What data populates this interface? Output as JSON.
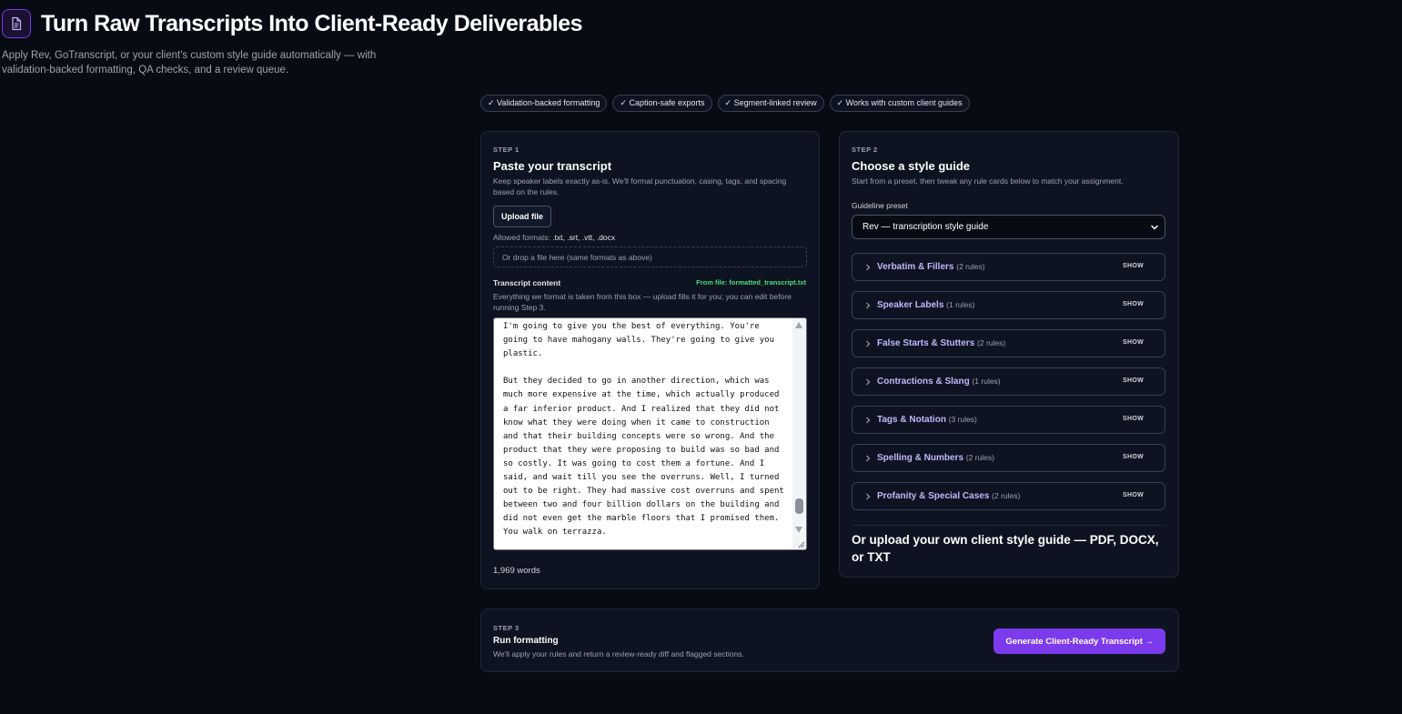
{
  "header": {
    "title": "Turn Raw Transcripts Into Client-Ready Deliverables",
    "subtitle": "Apply Rev, GoTranscript, or your client's custom style guide automatically — with validation-backed formatting, QA checks, and a review queue."
  },
  "features": [
    "✓ Validation-backed formatting",
    "✓ Caption-safe exports",
    "✓ Segment-linked review",
    "✓ Works with custom client guides"
  ],
  "step1": {
    "step_label": "STEP 1",
    "title": "Paste your transcript",
    "description": "Keep speaker labels exactly as-is. We'll format punctuation, casing, tags, and spacing based on the rules.",
    "upload_label": "Upload file",
    "allowed_prefix": "Allowed formats: ",
    "allowed_formats": ".txt, .srt, .vtt, .docx",
    "drop_text": "Or drop a file here (same formats as above)",
    "content_label": "Transcript content",
    "file_source": "From file: formatted_transcript.txt",
    "content_hint": "Everything we format is taken from this box — upload fills it for you; you can edit before running Step 3.",
    "transcript": "I'm going to give you the best of everything. You're going to have mahogany walls. They're going to give you plastic.\n\nBut they decided to go in another direction, which was much more expensive at the time, which actually produced a far inferior product. And I realized that they did not know what they were doing when it came to construction and that their building concepts were so wrong. And the product that they were proposing to build was so bad and so costly. It was going to cost them a fortune. And I said, and wait till you see the overruns. Well, I turned out to be right. They had massive cost overruns and spent between two and four billion dollars on the building and did not even get the marble floors that I promised them. You walk on terrazza.\n\nDo you notice that? As far as I'm concerned, frankly, looking at the building and getting stuck on the escalator,",
    "word_count": "1,969 words"
  },
  "step2": {
    "step_label": "STEP 2",
    "title": "Choose a style guide",
    "description": "Start from a preset, then tweak any rule cards below to match your assignment.",
    "preset_label": "Guideline preset",
    "preset_value": "Rev — transcription style guide",
    "rules": [
      {
        "title": "Verbatim & Fillers",
        "count": "(2 rules)",
        "action": "SHOW"
      },
      {
        "title": "Speaker Labels",
        "count": "(1 rules)",
        "action": "SHOW"
      },
      {
        "title": "False Starts & Stutters",
        "count": "(2 rules)",
        "action": "SHOW"
      },
      {
        "title": "Contractions & Slang",
        "count": "(1 rules)",
        "action": "SHOW"
      },
      {
        "title": "Tags & Notation",
        "count": "(3 rules)",
        "action": "SHOW"
      },
      {
        "title": "Spelling & Numbers",
        "count": "(2 rules)",
        "action": "SHOW"
      },
      {
        "title": "Profanity & Special Cases",
        "count": "(2 rules)",
        "action": "SHOW"
      }
    ],
    "upload_heading": "Or upload your own client style guide — PDF, DOCX, or TXT"
  },
  "step3": {
    "step_label": "STEP 3",
    "title": "Run formatting",
    "description": "We'll apply your rules and return a review-ready diff and flagged sections.",
    "cta_label": "Generate Client-Ready Transcript →"
  },
  "colors": {
    "background": "#070b14",
    "card": "#0d1320",
    "accent": "#7c3aed",
    "rule_title": "#c4b5fd",
    "file_source": "#4ade80"
  },
  "icons": {
    "logo": "document-icon",
    "rule_toggle": "chevron-right-icon",
    "select": "chevron-down-icon"
  }
}
